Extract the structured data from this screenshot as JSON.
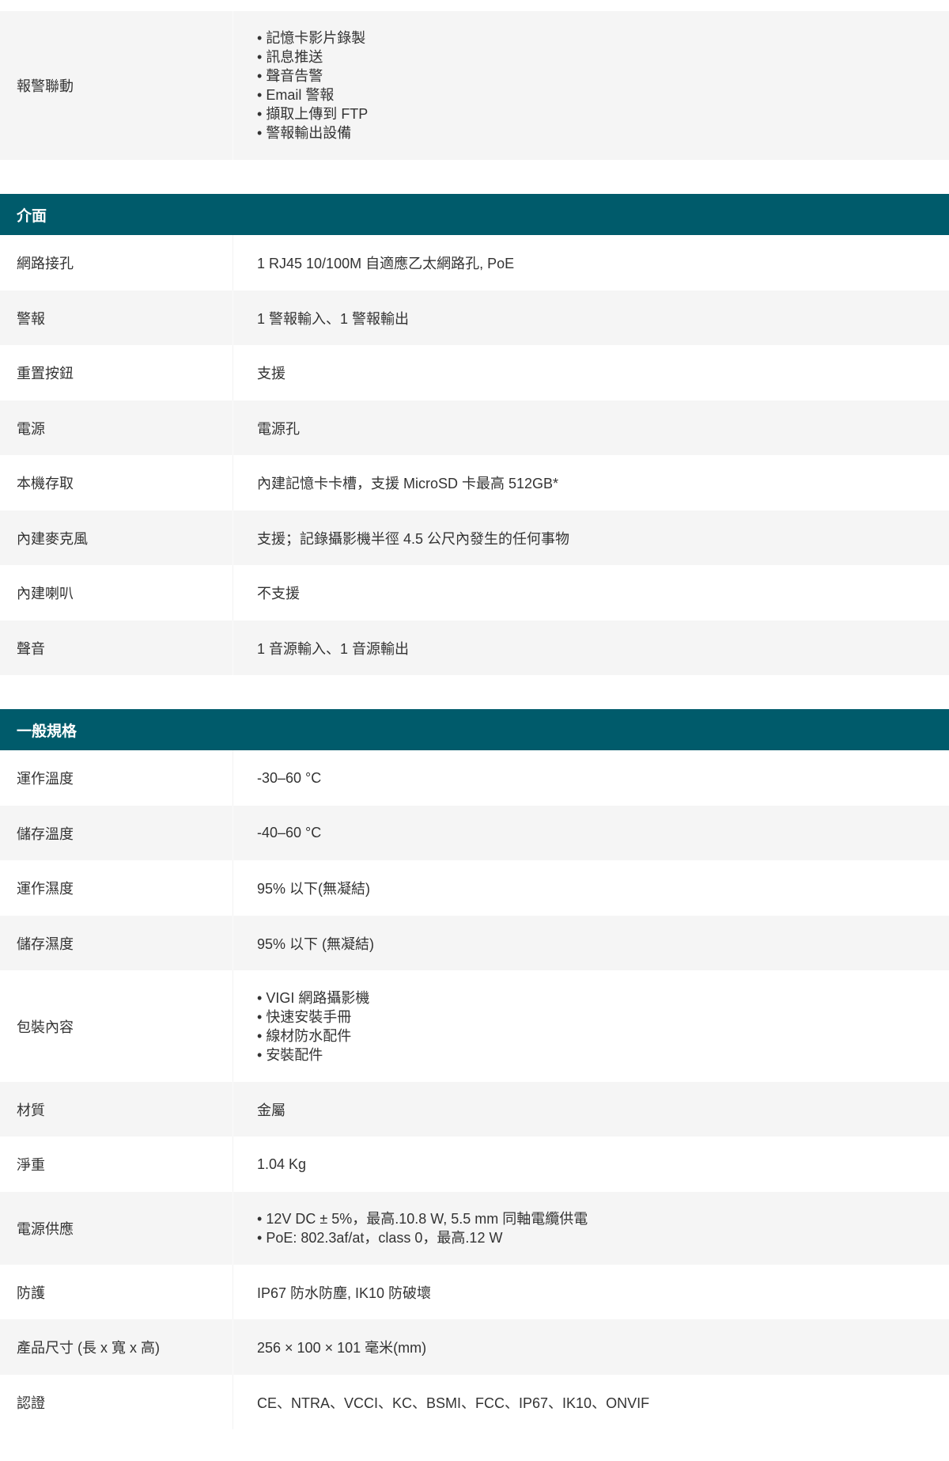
{
  "alarm_row": {
    "label": "報警聯動",
    "items": [
      "記憶卡影片錄製",
      "訊息推送",
      "聲音告警",
      "Email 警報",
      "擷取上傳到 FTP",
      "警報輸出設備"
    ]
  },
  "sections": [
    {
      "title": "介面",
      "rows": [
        {
          "label": "網路接孔",
          "value": "1 RJ45 10/100M 自適應乙太網路孔, PoE"
        },
        {
          "label": "警報",
          "value": "1 警報輸入、1 警報輸出"
        },
        {
          "label": "重置按鈕",
          "value": "支援"
        },
        {
          "label": "電源",
          "value": "電源孔"
        },
        {
          "label": "本機存取",
          "value": "內建記憶卡卡槽，支援 MicroSD 卡最高 512GB*"
        },
        {
          "label": "內建麥克風",
          "value": "支援；記錄攝影機半徑 4.5 公尺內發生的任何事物"
        },
        {
          "label": "內建喇叭",
          "value": "不支援"
        },
        {
          "label": "聲音",
          "value": "1 音源輸入、1 音源輸出"
        }
      ]
    },
    {
      "title": "一般規格",
      "rows": [
        {
          "label": "運作溫度",
          "value": "-30–60 °C"
        },
        {
          "label": "儲存溫度",
          "value": "-40–60 °C"
        },
        {
          "label": "運作濕度",
          "value": "95% 以下(無凝結)"
        },
        {
          "label": "儲存濕度",
          "value": "95% 以下 (無凝結)"
        },
        {
          "label": "包裝內容",
          "items": [
            "VIGI 網路攝影機",
            "快速安裝手冊",
            "線材防水配件",
            "安裝配件"
          ]
        },
        {
          "label": "材質",
          "value": "金屬"
        },
        {
          "label": "淨重",
          "value": "1.04 Kg"
        },
        {
          "label": "電源供應",
          "items": [
            "12V DC ± 5%，最高.10.8 W, 5.5 mm 同軸電纜供電",
            "PoE: 802.3af/at，class 0，最高.12 W"
          ]
        },
        {
          "label": "防護",
          "value": "IP67 防水防塵, IK10 防破壞"
        },
        {
          "label": "產品尺寸 (長 x 寬 x 高)",
          "value": "256 × 100 × 101 毫米(mm)"
        },
        {
          "label": "認證",
          "value": "CE、NTRA、VCCI、KC、BSMI、FCC、IP67、IK10、ONVIF"
        }
      ]
    }
  ]
}
